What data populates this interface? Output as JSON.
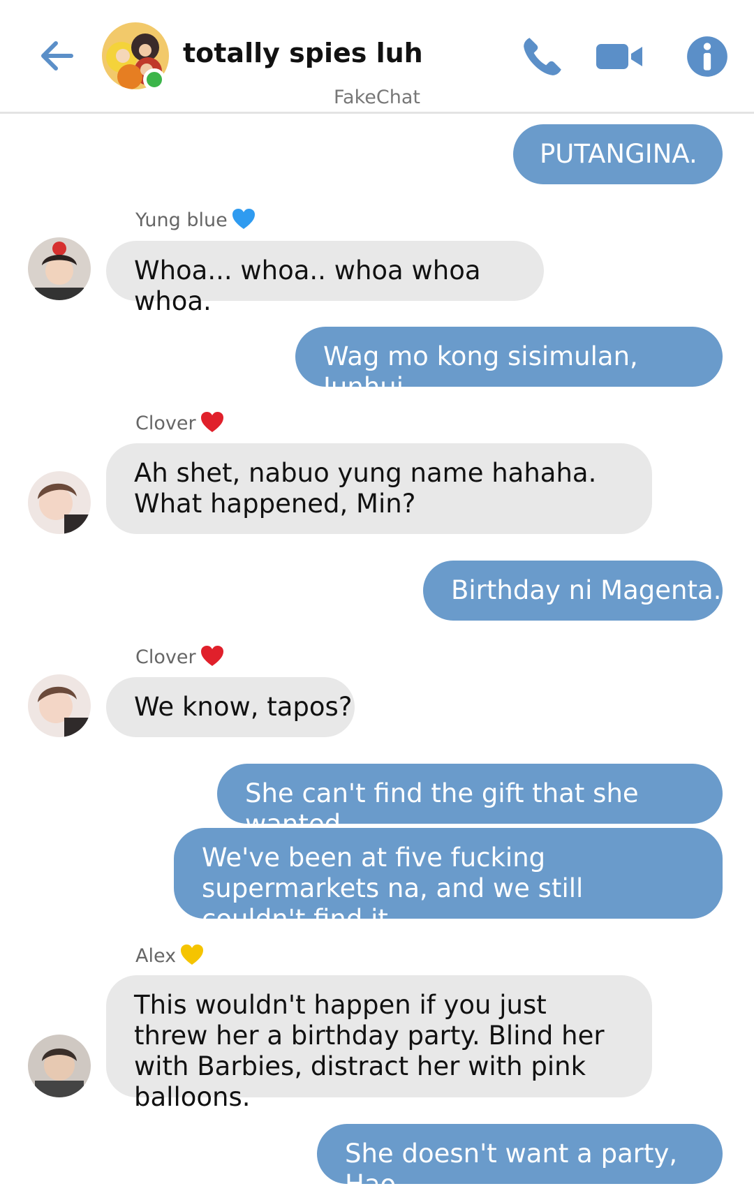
{
  "header": {
    "title": "totally spies luh",
    "watermark": "FakeChat",
    "accent_color": "#5b8fc8",
    "online_color": "#3cb54a"
  },
  "messages": [
    {
      "type": "outgoing",
      "text": "PUTANGINA."
    },
    {
      "type": "incoming",
      "sender": "Yung blue",
      "heart": "blue-heart-icon",
      "text": "Whoa... whoa.. whoa whoa whoa."
    },
    {
      "type": "outgoing",
      "text": "Wag mo kong sisimulan, Junhui."
    },
    {
      "type": "incoming",
      "sender": "Clover",
      "heart": "red-heart-icon",
      "text": "Ah shet, nabuo yung name hahaha. What happened, Min?"
    },
    {
      "type": "outgoing",
      "text": "Birthday ni Magenta."
    },
    {
      "type": "incoming",
      "sender": "Clover",
      "heart": "red-heart-icon",
      "text": "We know, tapos?"
    },
    {
      "type": "outgoing",
      "text": "She can't find the gift that she wanted."
    },
    {
      "type": "outgoing",
      "text": "We've been at five fucking supermarkets na, and we still couldn't find it."
    },
    {
      "type": "incoming",
      "sender": "Alex",
      "heart": "yellow-heart-icon",
      "text": "This wouldn't happen if you just threw her a birthday party. Blind her with Barbies, distract her with pink balloons."
    },
    {
      "type": "outgoing",
      "text": "She doesn't want a party, Hao."
    }
  ],
  "colors": {
    "outgoing_bubble": "#6a9bcb",
    "incoming_bubble": "#e8e8e8",
    "blue_heart": "#2f9bf0",
    "red_heart": "#e0202b",
    "yellow_heart": "#f5c400"
  }
}
